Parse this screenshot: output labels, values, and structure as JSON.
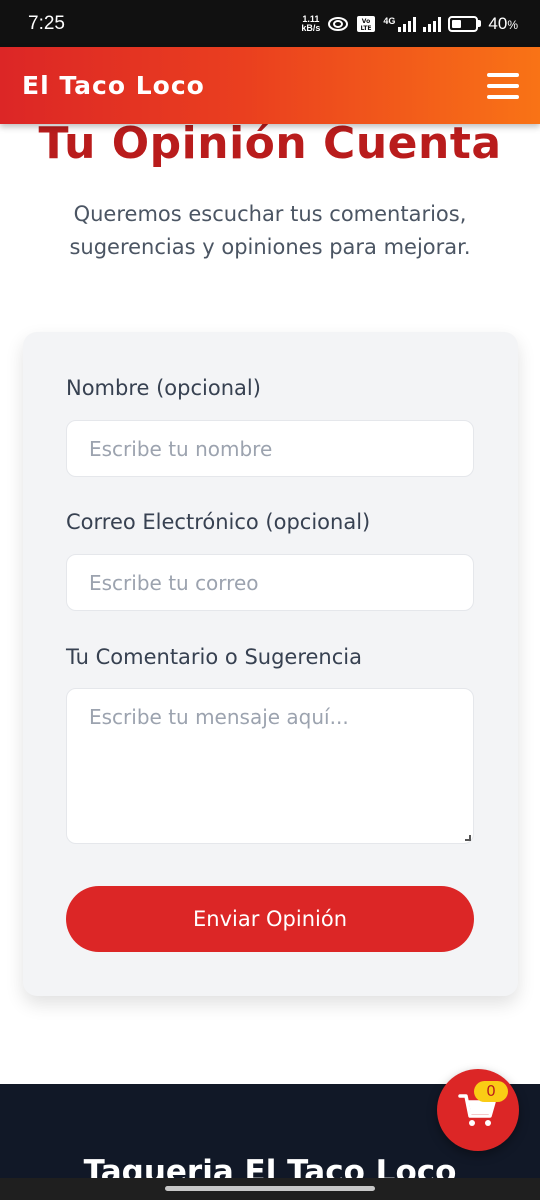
{
  "status_bar": {
    "time": "7:25",
    "net_speed_value": "1.11",
    "net_speed_unit": "kB/s",
    "volte_label": "Vo LTE",
    "network_type": "4G",
    "battery_percent": "40",
    "battery_unit": "%",
    "battery_level": 0.4
  },
  "navbar": {
    "brand": "El Taco Loco",
    "menu_icon": "hamburger-menu-icon",
    "gradient_start": "#dc2626",
    "gradient_end": "#f97316"
  },
  "hero": {
    "title": "Tu Opinión Cuenta",
    "subtitle": "Queremos escuchar tus comentarios, sugerencias y opiniones para mejorar."
  },
  "form": {
    "name_label": "Nombre (opcional)",
    "name_placeholder": "Escribe tu nombre",
    "email_label": "Correo Electrónico (opcional)",
    "email_placeholder": "Escribe tu correo",
    "comment_label": "Tu Comentario o Sugerencia",
    "comment_placeholder": "Escribe tu mensaje aquí...",
    "submit_label": "Enviar Opinión"
  },
  "footer": {
    "title": "Taqueria El Taco Loco"
  },
  "cart": {
    "icon": "shopping-cart-icon",
    "count": "0"
  },
  "colors": {
    "accent": "#dc2626",
    "title": "#b91c1c",
    "footer_bg": "#111827",
    "badge": "#facc15"
  }
}
